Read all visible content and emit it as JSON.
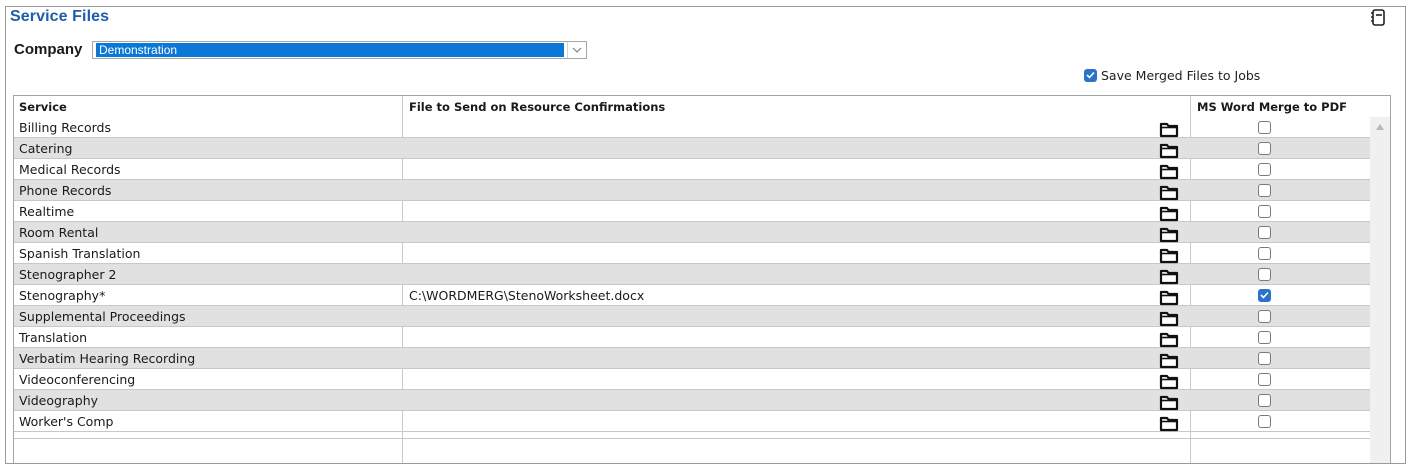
{
  "title": "Service Files",
  "company": {
    "label": "Company",
    "value": "Demonstration"
  },
  "save_merged": {
    "label": "Save Merged Files to Jobs",
    "checked": true
  },
  "columns": {
    "service": "Service",
    "file": "File to Send on Resource Confirmations",
    "pdf": "MS Word Merge to PDF"
  },
  "rows": [
    {
      "service": "Billing Records",
      "file": "",
      "pdf": false
    },
    {
      "service": "Catering",
      "file": "",
      "pdf": false
    },
    {
      "service": "Medical Records",
      "file": "",
      "pdf": false
    },
    {
      "service": "Phone Records",
      "file": "",
      "pdf": false
    },
    {
      "service": "Realtime",
      "file": "",
      "pdf": false
    },
    {
      "service": "Room Rental",
      "file": "",
      "pdf": false
    },
    {
      "service": "Spanish Translation",
      "file": "",
      "pdf": false
    },
    {
      "service": "Stenographer 2",
      "file": "",
      "pdf": false
    },
    {
      "service": "Stenography*",
      "file": "C:\\WORDMERG\\StenoWorksheet.docx",
      "pdf": true
    },
    {
      "service": "Supplemental Proceedings",
      "file": "",
      "pdf": false
    },
    {
      "service": "Translation",
      "file": "",
      "pdf": false
    },
    {
      "service": "Verbatim Hearing Recording",
      "file": "",
      "pdf": false
    },
    {
      "service": "Videoconferencing",
      "file": "",
      "pdf": false
    },
    {
      "service": "Videography",
      "file": "",
      "pdf": false
    },
    {
      "service": "Worker's Comp",
      "file": "",
      "pdf": false
    }
  ],
  "colors": {
    "accent": "#1f5da8",
    "selection": "#0b78d7",
    "checkbox": "#2a73c9",
    "alt_row": "#e1e1e1"
  },
  "icons": {
    "top_right": "notebook-icon",
    "folder": "folder-icon",
    "dropdown": "chevron-down-icon"
  }
}
